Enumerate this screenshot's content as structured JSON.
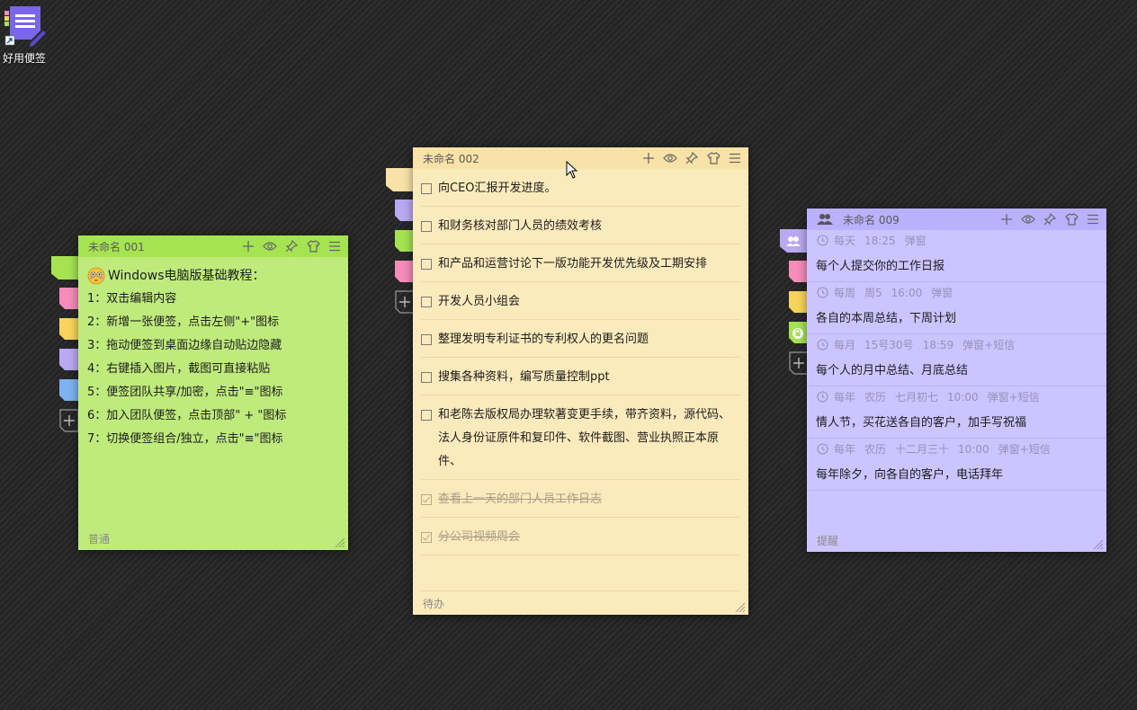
{
  "desktop_icon": {
    "label": "好用便签"
  },
  "notes": {
    "n1": {
      "title": "未命名 001",
      "footer": "普通",
      "lines": [
        "Windows电脑版基础教程：",
        "1：双击编辑内容",
        "2：新增一张便签，点击左侧\"+\"图标",
        "3：拖动便签到桌面边缘自动贴边隐藏",
        "4：右键插入图片，截图可直接粘贴",
        "5：便签团队共享/加密，点击\"≡\"图标",
        "6：加入团队便签，点击顶部\" + \"图标",
        "7：切换便签组合/独立，点击\"≡\"图标"
      ]
    },
    "n2": {
      "title": "未命名 002",
      "footer": "待办",
      "todos": [
        {
          "text": "向CEO汇报开发进度。",
          "done": false
        },
        {
          "text": "和财务核对部门人员的绩效考核",
          "done": false
        },
        {
          "text": "和产品和运营讨论下一版功能开发优先级及工期安排",
          "done": false
        },
        {
          "text": "开发人员小组会",
          "done": false
        },
        {
          "text": "整理发明专利证书的专利权人的更名问题",
          "done": false
        },
        {
          "text": "搜集各种资料，编写质量控制ppt",
          "done": false
        },
        {
          "text": "和老陈去版权局办理软著变更手续，带齐资料，源代码、法人身份证原件和复印件、软件截图、营业执照正本原件、",
          "done": false
        },
        {
          "text": "查看上一天的部门人员工作日志",
          "done": true
        },
        {
          "text": "分公司视频周会",
          "done": true
        }
      ]
    },
    "n3": {
      "title": "未命名 009",
      "footer": "提醒",
      "reminders": [
        {
          "meta": [
            "每天",
            "18:25",
            "弹窗"
          ],
          "content": "每个人提交你的工作日报"
        },
        {
          "meta": [
            "每周",
            "周5",
            "16:00",
            "弹窗"
          ],
          "content": "各自的本周总结，下周计划"
        },
        {
          "meta": [
            "每月",
            "15号30号",
            "18:59",
            "弹窗+短信"
          ],
          "content": "每个人的月中总结、月底总结"
        },
        {
          "meta": [
            "每年",
            "农历",
            "七月初七",
            "10:00",
            "弹窗+短信"
          ],
          "content": "情人节，买花送各自的客户，加手写祝福"
        },
        {
          "meta": [
            "每年",
            "农历",
            "十二月三十",
            "10:00",
            "弹窗+短信"
          ],
          "content": "每年除夕，向各自的客户，电话拜年"
        }
      ]
    }
  },
  "tab_colors": {
    "green": "#a5e351",
    "pink": "#f58cba",
    "yellow": "#f7d55c",
    "purple": "#b9a8f2",
    "blue": "#7fb2f0",
    "cream": "#f8e2a7"
  },
  "icons": [
    "plus-icon",
    "eye-icon",
    "pin-icon",
    "shirt-icon",
    "menu-icon",
    "group-icon",
    "clock-icon",
    "lock-icon",
    "resize-grip-icon"
  ]
}
